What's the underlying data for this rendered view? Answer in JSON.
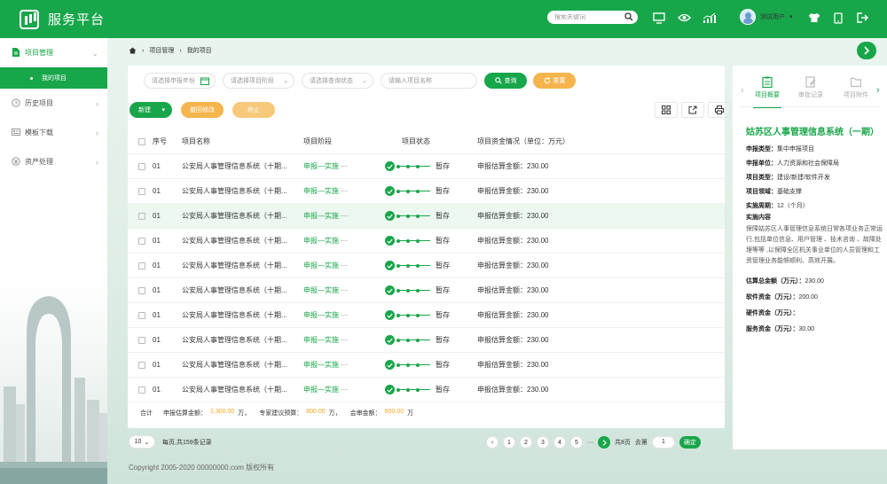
{
  "app": {
    "title": "服务平台"
  },
  "search": {
    "placeholder": "搜索关键词"
  },
  "user": {
    "name": "测试用户"
  },
  "sidebar": {
    "items": [
      {
        "label": "项目管理",
        "icon": "file-icon",
        "active": true
      },
      {
        "label": "历史项目",
        "icon": "clock-icon"
      },
      {
        "label": "模板下载",
        "icon": "template-icon"
      },
      {
        "label": "资产处理",
        "icon": "asset-icon"
      }
    ],
    "sub_item": "我的项目"
  },
  "breadcrumb": {
    "level1": "项目管理",
    "level2": "我的项目"
  },
  "filters": {
    "year": "请选择申报年份",
    "stage": "请选择项目阶段",
    "status": "请选择查询状态",
    "name": "请输入项目名称",
    "query": "查询",
    "reset": "重置"
  },
  "actions": {
    "new": "新建",
    "withdraw": "撤回修改",
    "stop": "终止"
  },
  "table": {
    "headers": [
      "序号",
      "项目名称",
      "项目阶段",
      "项目状态",
      "项目资金情况（单位：万元）"
    ],
    "rows": [
      {
        "no": "01",
        "name": "公安局人事管理信息系统（十期...",
        "stage_a": "申报",
        "stage_b": "—实施",
        "more": "···",
        "status": "暂存",
        "money": "申报估算金额：230.00"
      },
      {
        "no": "01",
        "name": "公安局人事管理信息系统（十期...",
        "stage_a": "申报",
        "stage_b": "—实施",
        "more": "···",
        "status": "暂存",
        "money": "申报估算金额：230.00"
      },
      {
        "no": "01",
        "name": "公安局人事管理信息系统（十期...",
        "stage_a": "申报",
        "stage_b": "—实施",
        "more": "···",
        "status": "暂存",
        "money": "申报估算金额：230.00"
      },
      {
        "no": "01",
        "name": "公安局人事管理信息系统（十期...",
        "stage_a": "申报",
        "stage_b": "—实施",
        "more": "···",
        "status": "暂存",
        "money": "申报估算金额：230.00"
      },
      {
        "no": "01",
        "name": "公安局人事管理信息系统（十期...",
        "stage_a": "申报",
        "stage_b": "—实施",
        "more": "···",
        "status": "暂存",
        "money": "申报估算金额：230.00"
      },
      {
        "no": "01",
        "name": "公安局人事管理信息系统（十期...",
        "stage_a": "申报",
        "stage_b": "—实施",
        "more": "···",
        "status": "暂存",
        "money": "申报估算金额：230.00"
      },
      {
        "no": "01",
        "name": "公安局人事管理信息系统（十期...",
        "stage_a": "申报",
        "stage_b": "—实施",
        "more": "···",
        "status": "暂存",
        "money": "申报估算金额：230.00"
      },
      {
        "no": "01",
        "name": "公安局人事管理信息系统（十期...",
        "stage_a": "申报",
        "stage_b": "—实施",
        "more": "···",
        "status": "暂存",
        "money": "申报估算金额：230.00"
      },
      {
        "no": "01",
        "name": "公安局人事管理信息系统（十期...",
        "stage_a": "申报",
        "stage_b": "—实施",
        "more": "···",
        "status": "暂存",
        "money": "申报估算金额：230.00"
      },
      {
        "no": "01",
        "name": "公安局人事管理信息系统（十期...",
        "stage_a": "申报",
        "stage_b": "—实施",
        "more": "···",
        "status": "暂存",
        "money": "申报估算金额：230.00"
      }
    ],
    "highlighted_row": 2
  },
  "totals": {
    "label": "合计",
    "declared_label": "申报估算金额：",
    "declared_value": "2,300.00",
    "unit": "万，",
    "expert_label": "专家建议预算：",
    "expert_value": "800.00",
    "audit_label": "会审金额：",
    "audit_value": "600.00",
    "unit_end": "万"
  },
  "pager": {
    "page_size": "10",
    "summary": "每页,共159条记录",
    "pages": [
      "1",
      "2",
      "3",
      "4",
      "5"
    ],
    "ellipsis": "···",
    "total_pages": "共8页",
    "goto_label": "去第",
    "goto_value": "1",
    "confirm": "确定"
  },
  "footer": {
    "copyright": "Copyright 2005-2020 00000000.com 版权所有"
  },
  "detail": {
    "tabs": [
      "项目概要",
      "审批记录",
      "项目附件"
    ],
    "title": "姑苏区人事管理信息系统（一期）",
    "fields": [
      {
        "label": "申报类型：",
        "value": "集中申报项目"
      },
      {
        "label": "申报单位：",
        "value": "人力资源和社会保障局"
      },
      {
        "label": "项目类型：",
        "value": "建设/新建/软件开发"
      },
      {
        "label": "项目领域：",
        "value": "基础支撑"
      },
      {
        "label": "实施周期：",
        "value": "12（个月）"
      }
    ],
    "content_label": "实施内容",
    "content": "保障姑苏区人事管理信息系统日常各项业务正常运行,包括单位信息、用户管理 、技术咨询 、故障处理等等 ,以保障全区机关事业单位的人员管理和工资管理业务能够顺利、高效开展。",
    "funds": [
      {
        "label": "估算总金额（万元）：",
        "value": "230.00"
      },
      {
        "label": "软件资金（万元）：",
        "value": "200.00"
      },
      {
        "label": "硬件资金（万元）：",
        "value": ""
      },
      {
        "label": "服务资金（万元）：",
        "value": "30.00"
      }
    ]
  },
  "colors": {
    "primary": "#18a64a",
    "accent": "#f5b54d",
    "amount": "#f5a623"
  }
}
